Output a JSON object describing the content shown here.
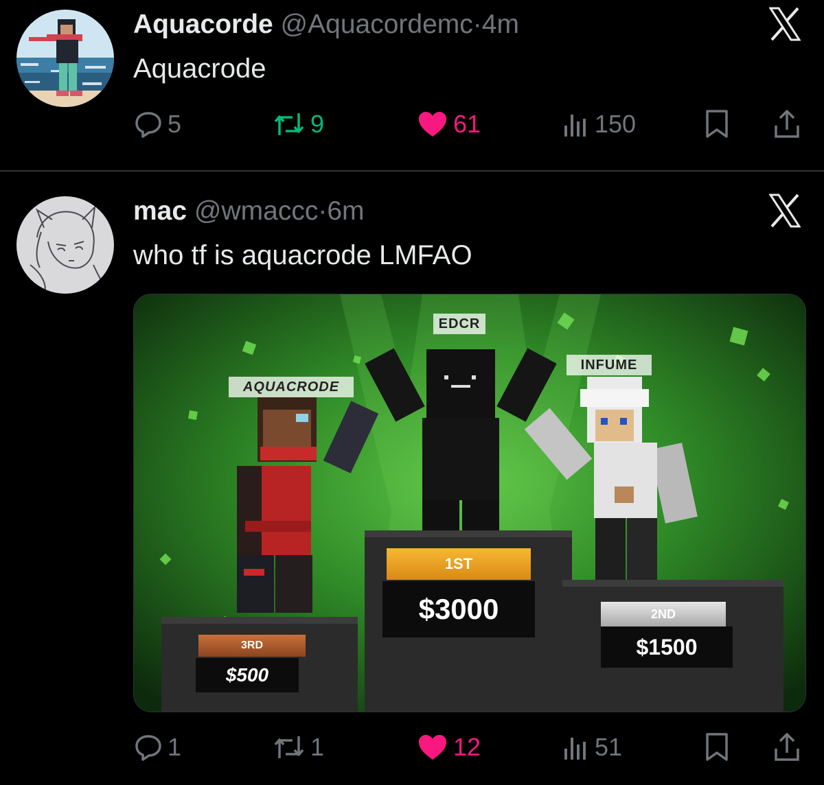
{
  "tweets": [
    {
      "name": "Aquacorde",
      "handle": "@Aquacordemc",
      "time": "4m",
      "text": "Aquacrode",
      "replies": "5",
      "retweets": "9",
      "likes": "61",
      "views": "150",
      "retweeted": true,
      "liked": true
    },
    {
      "name": "mac",
      "handle": "@wmaccc",
      "time": "6m",
      "text": "who tf is aquacrode LMFAO",
      "replies": "1",
      "retweets": "1",
      "likes": "12",
      "views": "51",
      "retweeted": false,
      "liked": true
    }
  ],
  "media": {
    "first_place": {
      "name": "EDCR",
      "rank": "1ST",
      "prize": "$3000"
    },
    "second_place": {
      "name": "INFUME",
      "rank": "2ND",
      "prize": "$1500"
    },
    "third_place": {
      "name": "AQUACRODE",
      "rank": "3RD",
      "prize": "$500"
    }
  },
  "icons": {
    "close": "x-logo-icon",
    "reply": "reply-icon",
    "retweet": "retweet-icon",
    "like": "heart-icon",
    "views": "views-icon",
    "bookmark": "bookmark-icon",
    "share": "share-icon"
  },
  "colors": {
    "background": "#000000",
    "text": "#e7e9ea",
    "muted": "#71767b",
    "retweet_active": "#00ba7c",
    "like_active": "#f91880",
    "divider": "#2f3336"
  }
}
